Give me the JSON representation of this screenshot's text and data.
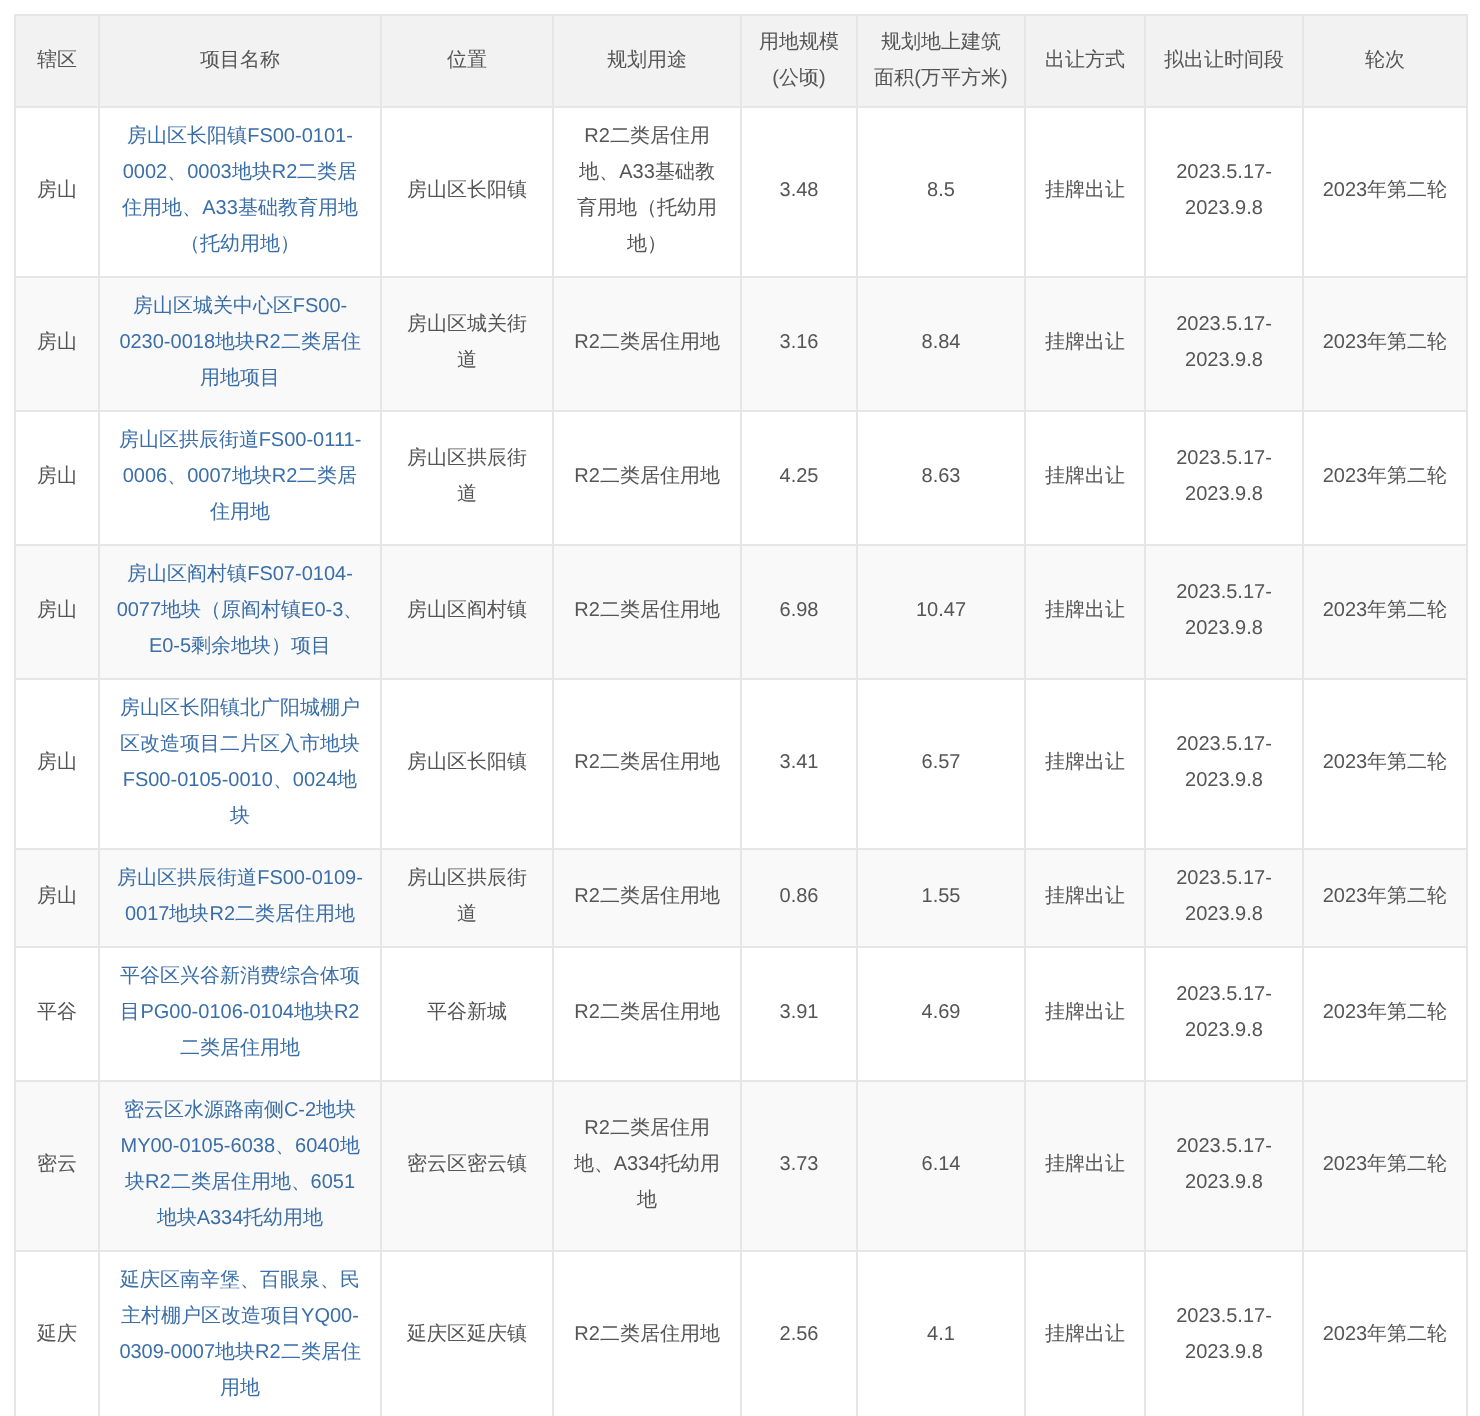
{
  "table": {
    "columns": [
      [
        "辖区"
      ],
      [
        "项目名称"
      ],
      [
        "位置"
      ],
      [
        "规划用途"
      ],
      [
        "用地规模",
        "(公顷)"
      ],
      [
        "规划地上建筑",
        "面积(万平方米)"
      ],
      [
        "出让方式"
      ],
      [
        "拟出让时间段"
      ],
      [
        "轮次"
      ]
    ],
    "rows": [
      {
        "district": "房山",
        "project": "房山区长阳镇FS00-0101-0002、0003地块R2二类居住用地、A33基础教育用地（托幼用地）",
        "location": "房山区长阳镇",
        "use": "R2二类居住用地、A33基础教育用地（托幼用地）",
        "area": "3.48",
        "floor_area": "8.5",
        "method": "挂牌出让",
        "period": "2023.5.17-2023.9.8",
        "round": "2023年第二轮"
      },
      {
        "district": "房山",
        "project": "房山区城关中心区FS00-0230-0018地块R2二类居住用地项目",
        "location": "房山区城关街道",
        "use": "R2二类居住用地",
        "area": "3.16",
        "floor_area": "8.84",
        "method": "挂牌出让",
        "period": "2023.5.17-2023.9.8",
        "round": "2023年第二轮"
      },
      {
        "district": "房山",
        "project": "房山区拱辰街道FS00-0111-0006、0007地块R2二类居住用地",
        "location": "房山区拱辰街道",
        "use": "R2二类居住用地",
        "area": "4.25",
        "floor_area": "8.63",
        "method": "挂牌出让",
        "period": "2023.5.17-2023.9.8",
        "round": "2023年第二轮"
      },
      {
        "district": "房山",
        "project": "房山区阎村镇FS07-0104-0077地块（原阎村镇E0-3、E0-5剩余地块）项目",
        "location": "房山区阎村镇",
        "use": "R2二类居住用地",
        "area": "6.98",
        "floor_area": "10.47",
        "method": "挂牌出让",
        "period": "2023.5.17-2023.9.8",
        "round": "2023年第二轮"
      },
      {
        "district": "房山",
        "project": "房山区长阳镇北广阳城棚户区改造项目二片区入市地块FS00-0105-0010、0024地块",
        "location": "房山区长阳镇",
        "use": "R2二类居住用地",
        "area": "3.41",
        "floor_area": "6.57",
        "method": "挂牌出让",
        "period": "2023.5.17-2023.9.8",
        "round": "2023年第二轮"
      },
      {
        "district": "房山",
        "project": "房山区拱辰街道FS00-0109-0017地块R2二类居住用地",
        "location": "房山区拱辰街道",
        "use": "R2二类居住用地",
        "area": "0.86",
        "floor_area": "1.55",
        "method": "挂牌出让",
        "period": "2023.5.17-2023.9.8",
        "round": "2023年第二轮"
      },
      {
        "district": "平谷",
        "project": "平谷区兴谷新消费综合体项目PG00-0106-0104地块R2二类居住用地",
        "location": "平谷新城",
        "use": "R2二类居住用地",
        "area": "3.91",
        "floor_area": "4.69",
        "method": "挂牌出让",
        "period": "2023.5.17-2023.9.8",
        "round": "2023年第二轮"
      },
      {
        "district": "密云",
        "project": "密云区水源路南侧C-2地块MY00-0105-6038、6040地块R2二类居住用地、6051地块A334托幼用地",
        "location": "密云区密云镇",
        "use": "R2二类居住用地、A334托幼用地",
        "area": "3.73",
        "floor_area": "6.14",
        "method": "挂牌出让",
        "period": "2023.5.17-2023.9.8",
        "round": "2023年第二轮"
      },
      {
        "district": "延庆",
        "project": "延庆区南辛堡、百眼泉、民主村棚户区改造项目YQ00-0309-0007地块R2二类居住用地",
        "location": "延庆区延庆镇",
        "use": "R2二类居住用地",
        "area": "2.56",
        "floor_area": "4.1",
        "method": "挂牌出让",
        "period": "2023.5.17-2023.9.8",
        "round": "2023年第二轮"
      }
    ]
  }
}
